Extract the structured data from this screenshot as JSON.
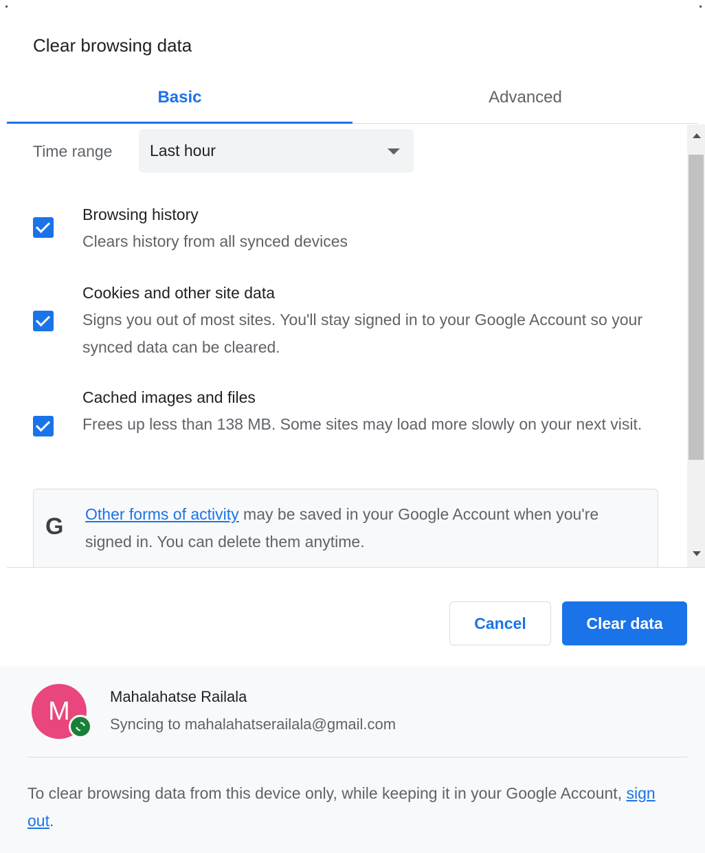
{
  "dialog": {
    "title": "Clear browsing data"
  },
  "tabs": [
    {
      "label": "Basic",
      "active": true
    },
    {
      "label": "Advanced",
      "active": false
    }
  ],
  "time_range": {
    "label": "Time range",
    "selected": "Last hour"
  },
  "options": [
    {
      "title": "Browsing history",
      "description": "Clears history from all synced devices",
      "checked": true
    },
    {
      "title": "Cookies and other site data",
      "description": "Signs you out of most sites. You'll stay signed in to your Google Account so your synced data can be cleared.",
      "checked": true
    },
    {
      "title": "Cached images and files",
      "description": "Frees up less than 138 MB. Some sites may load more slowly on your next visit.",
      "checked": true
    }
  ],
  "info": {
    "icon_letter": "G",
    "link_text": "Other forms of activity",
    "text_after_link": " may be saved in your Google Account when you're signed in. You can delete them anytime."
  },
  "buttons": {
    "cancel": "Cancel",
    "clear": "Clear data"
  },
  "account": {
    "avatar_letter": "M",
    "name": "Mahalahatse Railala",
    "sync_status": "Syncing to mahalahatserailala@gmail.com"
  },
  "footer": {
    "text_before_link": "To clear browsing data from this device only, while keeping it in your Google Account, ",
    "link_text": "sign out",
    "text_after_link": "."
  },
  "colors": {
    "accent": "#1a73e8",
    "avatar": "#e8467c",
    "sync_badge": "#188038"
  }
}
